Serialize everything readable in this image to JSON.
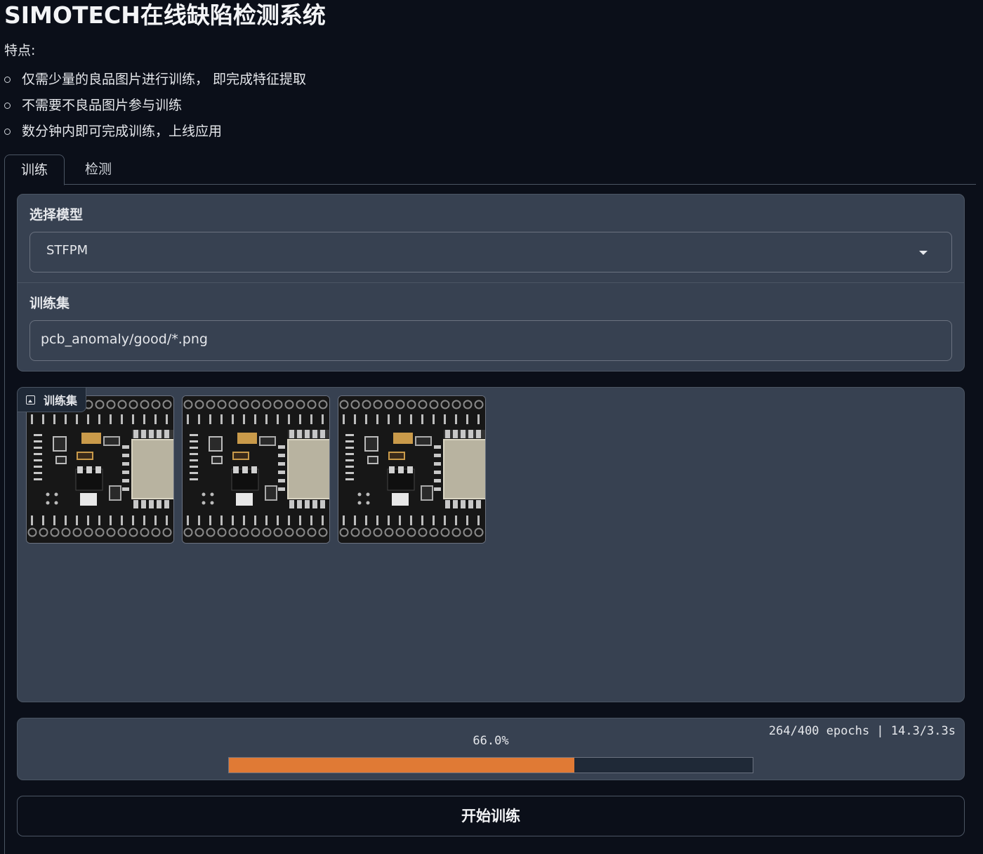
{
  "page": {
    "title": "SIMOTECH在线缺陷检测系统",
    "features_label": "特点:",
    "features": [
      "仅需少量的良品图片进行训练， 即完成特征提取",
      "不需要不良品图片参与训练",
      "数分钟内即可完成训练，上线应用"
    ]
  },
  "tabs": [
    {
      "label": "训练",
      "active": true
    },
    {
      "label": "检测",
      "active": false
    }
  ],
  "form": {
    "model_label": "选择模型",
    "model_value": "STFPM",
    "train_set_label": "训练集",
    "train_set_value": "pcb_anomaly/good/*.png"
  },
  "gallery": {
    "label": "训练集",
    "image_count": 3
  },
  "progress": {
    "percent_text": "66.0%",
    "fraction": 0.66,
    "eta_text": "264/400 epochs | 14.3/3.3s"
  },
  "actions": {
    "start_label": "开始训练"
  },
  "colors": {
    "background": "#0b0f19",
    "panel": "#374151",
    "progress_fill": "#e07a35"
  }
}
